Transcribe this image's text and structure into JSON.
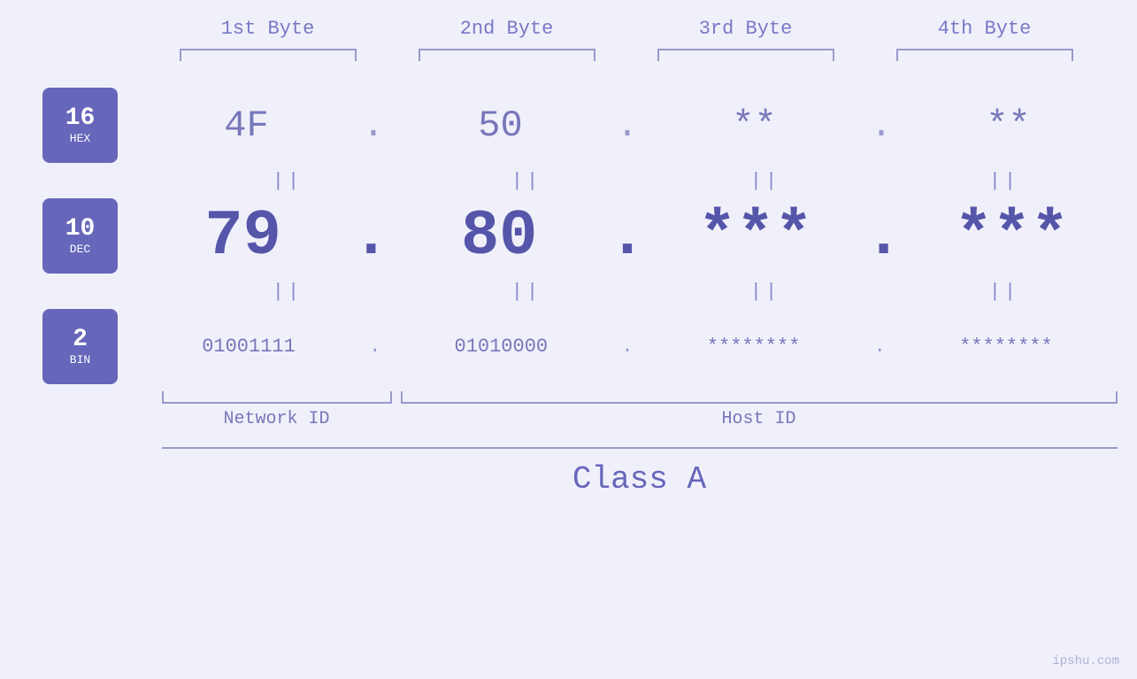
{
  "headers": {
    "byte1": "1st Byte",
    "byte2": "2nd Byte",
    "byte3": "3rd Byte",
    "byte4": "4th Byte"
  },
  "badges": {
    "hex": {
      "num": "16",
      "label": "HEX"
    },
    "dec": {
      "num": "10",
      "label": "DEC"
    },
    "bin": {
      "num": "2",
      "label": "BIN"
    }
  },
  "values": {
    "hex": [
      "4F",
      "50",
      "**",
      "**"
    ],
    "dec": [
      "79",
      "80",
      "***",
      "***"
    ],
    "bin": [
      "01001111",
      "01010000",
      "********",
      "********"
    ]
  },
  "separators": {
    "hex_sep": ".",
    "dec_sep": ".",
    "bin_sep": "."
  },
  "equals": "||",
  "labels": {
    "network_id": "Network ID",
    "host_id": "Host ID",
    "class": "Class A"
  },
  "watermark": "ipshu.com"
}
